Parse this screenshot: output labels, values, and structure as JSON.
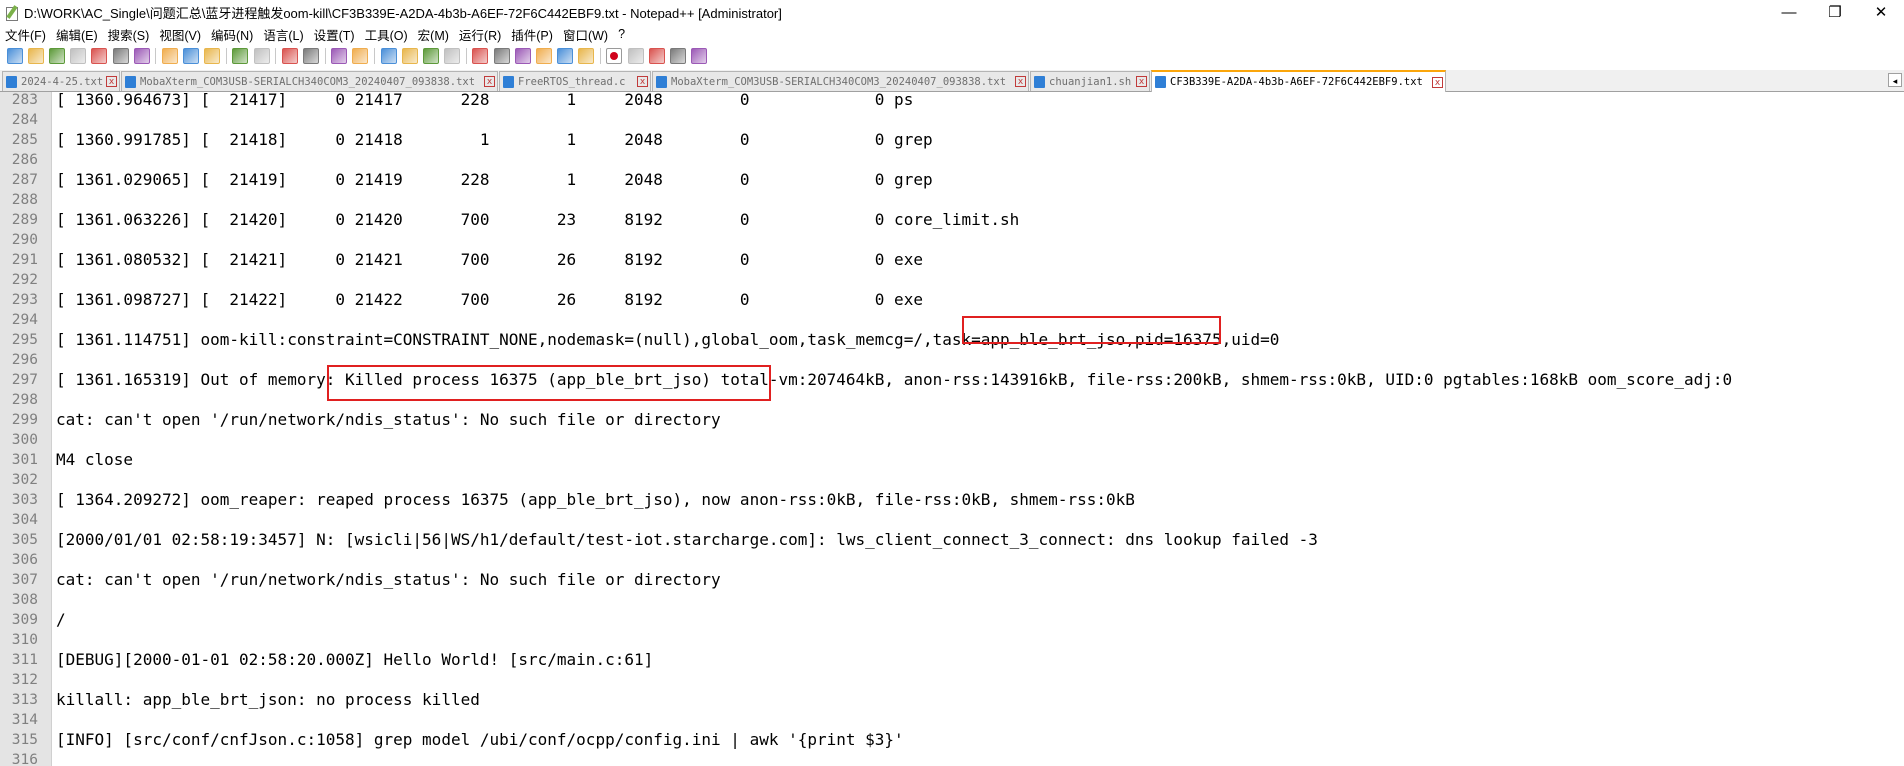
{
  "window": {
    "title": "D:\\WORK\\AC_Single\\问题汇总\\蓝牙进程触发oom-kill\\CF3B339E-A2DA-4b3b-A6EF-72F6C442EBF9.txt - Notepad++ [Administrator]",
    "minimize_glyph": "—",
    "restore_glyph": "❐",
    "close_glyph": "✕"
  },
  "menu": [
    "文件(F)",
    "编辑(E)",
    "搜索(S)",
    "视图(V)",
    "编码(N)",
    "语言(L)",
    "设置(T)",
    "工具(O)",
    "宏(M)",
    "运行(R)",
    "插件(P)",
    "窗口(W)",
    "?"
  ],
  "tabs": [
    {
      "label": "2024-4-25.txt",
      "active": false
    },
    {
      "label": "MobaXterm_COM3USB-SERIALCH340COM3_20240407_093838.txt",
      "active": false
    },
    {
      "label": "FreeRTOS_thread.c",
      "active": false
    },
    {
      "label": "MobaXterm_COM3USB-SERIALCH340COM3_20240407_093838.txt",
      "active": false
    },
    {
      "label": "chuanjian1.sh",
      "active": false
    },
    {
      "label": "CF3B339E-A2DA-4b3b-A6EF-72F6C442EBF9.txt",
      "active": true
    }
  ],
  "tab_close_glyph": "x",
  "tab_scroll_glyph": "◂",
  "editor": {
    "lines": [
      {
        "num": "283",
        "text": "[ 1360.964673] [  21417]     0 21417      228        1     2048        0             0 ps"
      },
      {
        "num": "284",
        "text": ""
      },
      {
        "num": "285",
        "text": "[ 1360.991785] [  21418]     0 21418        1        1     2048        0             0 grep"
      },
      {
        "num": "286",
        "text": ""
      },
      {
        "num": "287",
        "text": "[ 1361.029065] [  21419]     0 21419      228        1     2048        0             0 grep"
      },
      {
        "num": "288",
        "text": ""
      },
      {
        "num": "289",
        "text": "[ 1361.063226] [  21420]     0 21420      700       23     8192        0             0 core_limit.sh"
      },
      {
        "num": "290",
        "text": ""
      },
      {
        "num": "291",
        "text": "[ 1361.080532] [  21421]     0 21421      700       26     8192        0             0 exe"
      },
      {
        "num": "292",
        "text": ""
      },
      {
        "num": "293",
        "text": "[ 1361.098727] [  21422]     0 21422      700       26     8192        0             0 exe"
      },
      {
        "num": "294",
        "text": ""
      },
      {
        "num": "295",
        "text": "[ 1361.114751] oom-kill:constraint=CONSTRAINT_NONE,nodemask=(null),global_oom,task_memcg=/,task=app_ble_brt_jso,pid=16375,uid=0"
      },
      {
        "num": "296",
        "text": ""
      },
      {
        "num": "297",
        "text": "[ 1361.165319] Out of memory: Killed process 16375 (app_ble_brt_jso) total-vm:207464kB, anon-rss:143916kB, file-rss:200kB, shmem-rss:0kB, UID:0 pgtables:168kB oom_score_adj:0"
      },
      {
        "num": "298",
        "text": ""
      },
      {
        "num": "299",
        "text": "cat: can't open '/run/network/ndis_status': No such file or directory"
      },
      {
        "num": "300",
        "text": ""
      },
      {
        "num": "301",
        "text": "M4 close"
      },
      {
        "num": "302",
        "text": ""
      },
      {
        "num": "303",
        "text": "[ 1364.209272] oom_reaper: reaped process 16375 (app_ble_brt_jso), now anon-rss:0kB, file-rss:0kB, shmem-rss:0kB"
      },
      {
        "num": "304",
        "text": ""
      },
      {
        "num": "305",
        "text": "[2000/01/01 02:58:19:3457] N: [wsicli|56|WS/h1/default/test-iot.starcharge.com]: lws_client_connect_3_connect: dns lookup failed -3"
      },
      {
        "num": "306",
        "text": ""
      },
      {
        "num": "307",
        "text": "cat: can't open '/run/network/ndis_status': No such file or directory"
      },
      {
        "num": "308",
        "text": ""
      },
      {
        "num": "309",
        "text": "/"
      },
      {
        "num": "310",
        "text": ""
      },
      {
        "num": "311",
        "text": "[DEBUG][2000-01-01 02:58:20.000Z] Hello World! [src/main.c:61]"
      },
      {
        "num": "312",
        "text": ""
      },
      {
        "num": "313",
        "text": "killall: app_ble_brt_json: no process killed"
      },
      {
        "num": "314",
        "text": ""
      },
      {
        "num": "315",
        "text": "[INFO] [src/conf/cnfJson.c:1058] grep model /ubi/conf/ocpp/config.ini | awk '{print $3}'"
      },
      {
        "num": "316",
        "text": ""
      }
    ]
  },
  "colors": {
    "highlight_box": "#e02020",
    "active_tab_accent": "#fba60b",
    "gutter_bg": "#e4e4e4"
  },
  "toolbar_icons": [
    "new-file-icon",
    "open-file-icon",
    "save-icon",
    "save-all-icon",
    "close-icon",
    "close-all-icon",
    "print-icon",
    "cut-icon",
    "copy-icon",
    "paste-icon",
    "undo-icon",
    "redo-icon",
    "find-icon",
    "replace-icon",
    "zoom-in-icon",
    "zoom-out-icon",
    "sync-vertical-icon",
    "sync-horizontal-icon",
    "word-wrap-icon",
    "show-all-chars-icon",
    "indent-guide-icon",
    "udl-icon",
    "doc-map-icon",
    "function-list-icon",
    "folder-workspace-icon",
    "monitoring-icon",
    "record-macro-icon",
    "stop-record-icon",
    "playback-macro-icon",
    "run-macro-multiple-icon",
    "save-macro-icon"
  ]
}
